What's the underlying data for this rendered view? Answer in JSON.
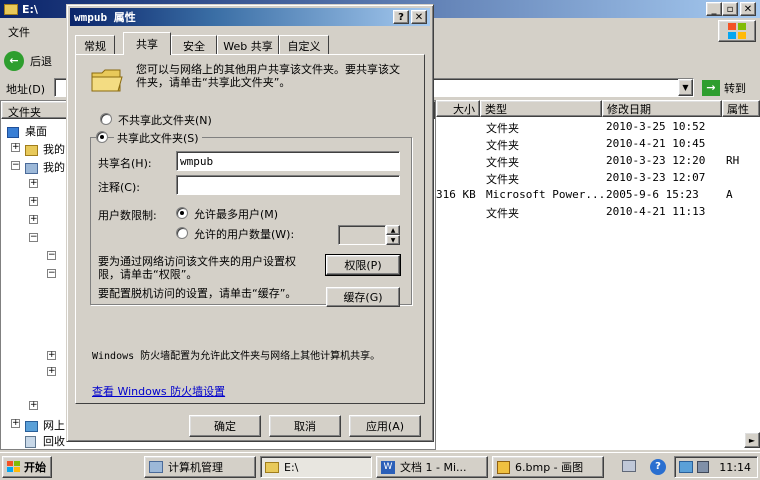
{
  "explorer": {
    "title": "E:\\",
    "menu_file": "文件",
    "back_label": "后退",
    "address_label": "地址",
    "address_hotkey": "(D)",
    "go_label": "转到",
    "folders_label": "文件夹",
    "columns": [
      "大小",
      "类型",
      "修改日期",
      "属性"
    ],
    "rows": [
      {
        "size": "",
        "type": "文件夹",
        "date": "2010-3-25 10:52",
        "attr": ""
      },
      {
        "size": "",
        "type": "文件夹",
        "date": "2010-4-21 10:45",
        "attr": ""
      },
      {
        "size": "",
        "type": "文件夹",
        "date": "2010-3-23 12:20",
        "attr": "RH"
      },
      {
        "size": "",
        "type": "文件夹",
        "date": "2010-3-23 12:07",
        "attr": ""
      },
      {
        "size": "316 KB",
        "type": "Microsoft Power...",
        "date": "2005-9-6 15:23",
        "attr": "A"
      },
      {
        "size": "",
        "type": "文件夹",
        "date": "2010-4-21 11:13",
        "attr": ""
      }
    ],
    "tree": {
      "desktop": "桌面",
      "mydocs": "我的",
      "mycomputer": "我的",
      "network": "网上",
      "recycle": "回收"
    }
  },
  "dialog": {
    "title": "wmpub 属性",
    "tabs": [
      "常规",
      "共享",
      "安全",
      "Web 共享",
      "自定义"
    ],
    "active_tab": "共享",
    "intro": "您可以与网络上的其他用户共享该文件夹。要共享该文件夹，请单击“共享此文件夹”。",
    "radio_noshare": "不共享此文件夹(N)",
    "radio_share": "共享此文件夹(S)",
    "share_name_label": "共享名(H):",
    "share_name_value": "wmpub",
    "comment_label": "注释(C):",
    "comment_value": "",
    "user_limit_label": "用户数限制:",
    "radio_max": "允许最多用户(M)",
    "radio_allowed": "允许的用户数量(W):",
    "perm_text": "要为通过网络访问该文件夹的用户设置权限，请单击“权限”。",
    "perm_button": "权限(P)",
    "cache_text": "要配置脱机访问的设置，请单击“缓存”。",
    "cache_button": "缓存(G)",
    "firewall_text": "Windows 防火墙配置为允许此文件夹与网络上其他计算机共享。",
    "firewall_link": "查看 Windows 防火墙设置",
    "ok": "确定",
    "cancel": "取消",
    "apply": "应用(A)"
  },
  "taskbar": {
    "start": "开始",
    "tasks": [
      "计算机管理",
      "E:\\",
      "文档 1 - Mi...",
      "6.bmp - 画图"
    ],
    "clock": "11:14"
  }
}
